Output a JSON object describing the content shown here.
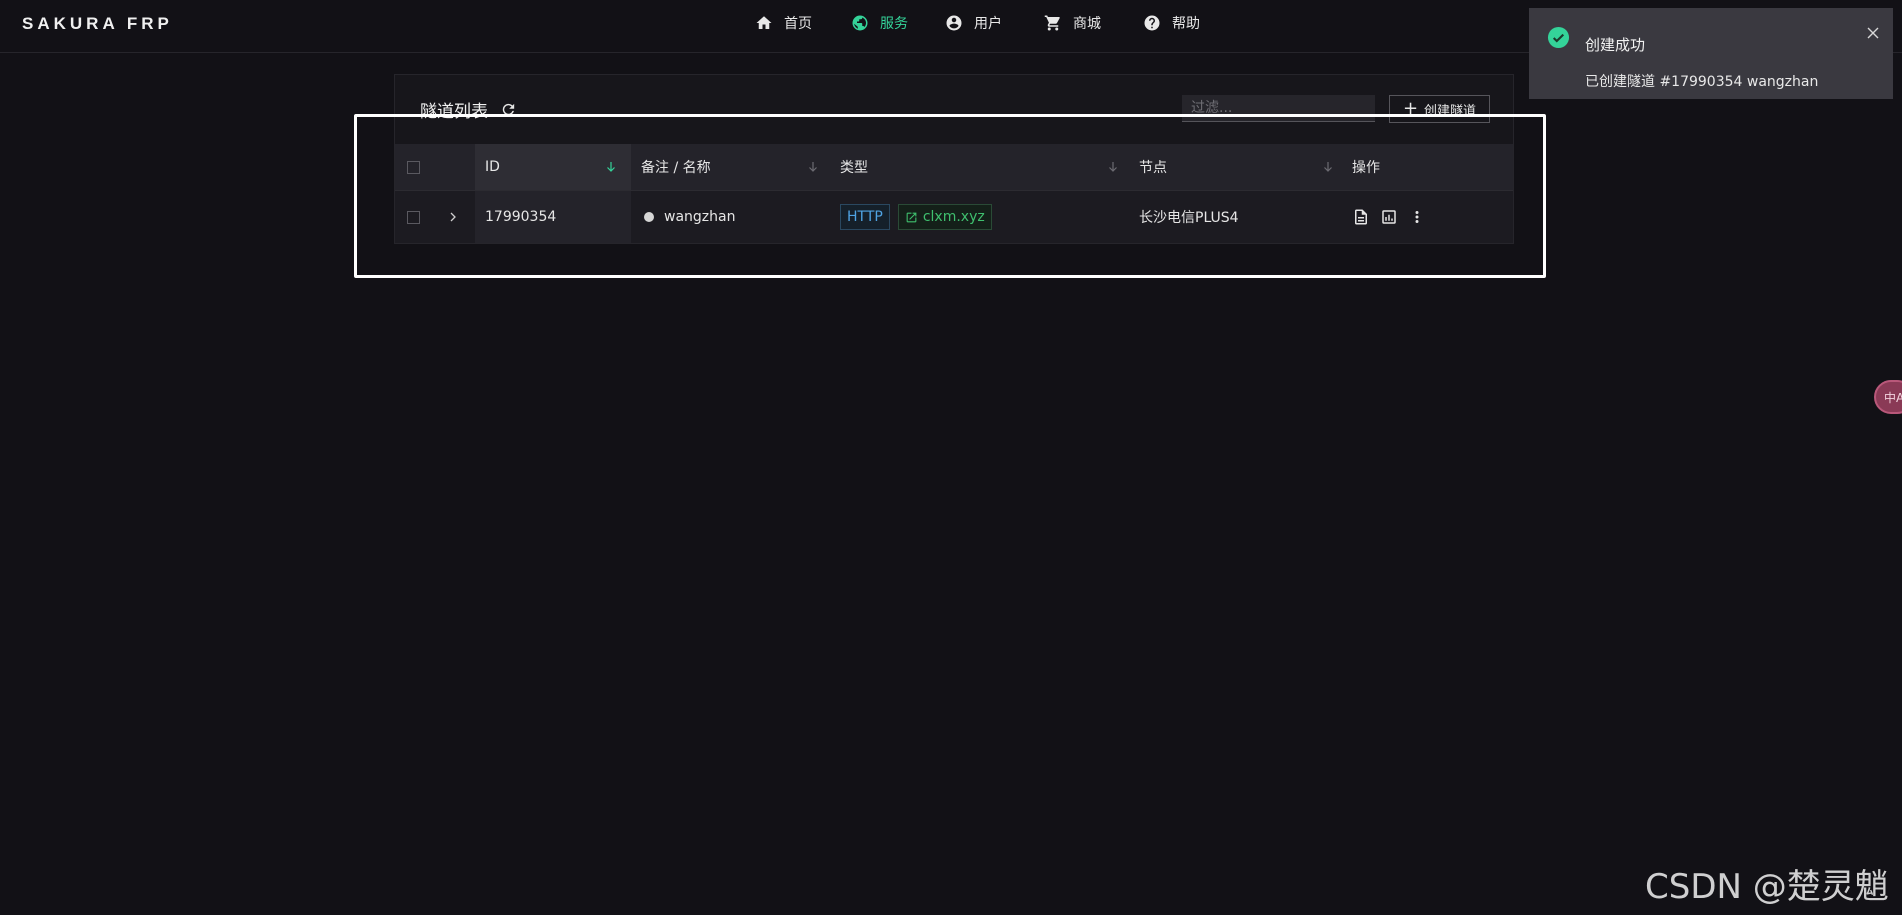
{
  "app": {
    "logo": "SAKURA FRP"
  },
  "nav": {
    "items": [
      {
        "label": "首页",
        "icon": "home-icon",
        "active": false
      },
      {
        "label": "服务",
        "icon": "globe-icon",
        "active": true
      },
      {
        "label": "用户",
        "icon": "user-circle-icon",
        "active": false
      },
      {
        "label": "商城",
        "icon": "cart-icon",
        "active": false
      },
      {
        "label": "帮助",
        "icon": "help-icon",
        "active": false
      }
    ]
  },
  "tunnels": {
    "title": "隧道列表",
    "filter_placeholder": "过滤...",
    "create_label": "创建隧道",
    "columns": {
      "id": "ID",
      "name": "备注 / 名称",
      "type": "类型",
      "node": "节点",
      "actions": "操作"
    },
    "rows": [
      {
        "id": "17990354",
        "name": "wangzhan",
        "type": "HTTP",
        "domain": "clxm.xyz",
        "node": "长沙电信PLUS4"
      }
    ]
  },
  "toast": {
    "title": "创建成功",
    "message": "已创建隧道 #17990354 wangzhan"
  },
  "side_float": {
    "label": "中A"
  },
  "watermark": "CSDN @楚灵魈",
  "colors": {
    "background": "#121116",
    "accent": "#34d399",
    "http_tag": "#4fa3e3",
    "domain_tag": "#3fbf6e"
  }
}
